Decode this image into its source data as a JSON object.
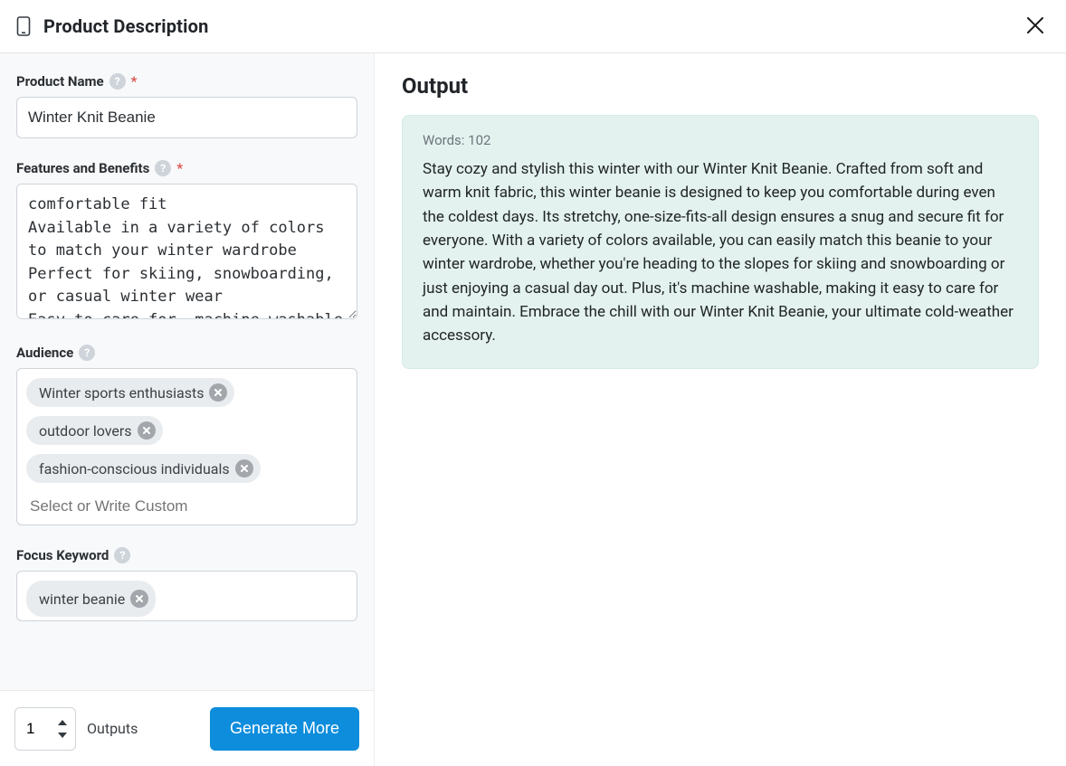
{
  "header": {
    "title": "Product Description"
  },
  "form": {
    "productName": {
      "label": "Product Name",
      "required": true,
      "value": "Winter Knit Beanie"
    },
    "features": {
      "label": "Features and Benefits",
      "required": true,
      "value": "comfortable fit\nAvailable in a variety of colors to match your winter wardrobe\nPerfect for skiing, snowboarding, or casual winter wear\nEasy to care for, machine washable"
    },
    "audience": {
      "label": "Audience",
      "tags": [
        "Winter sports enthusiasts",
        "outdoor lovers",
        "fashion-conscious individuals"
      ],
      "placeholder": "Select or Write Custom"
    },
    "focusKeyword": {
      "label": "Focus Keyword",
      "tags": [
        "winter beanie"
      ]
    }
  },
  "footer": {
    "outputsCount": "1",
    "outputsLabel": "Outputs",
    "generateLabel": "Generate More"
  },
  "output": {
    "heading": "Output",
    "wordCountLabel": "Words: 102",
    "body": "Stay cozy and stylish this winter with our Winter Knit Beanie. Crafted from soft and warm knit fabric, this winter beanie is designed to keep you comfortable during even the coldest days. Its stretchy, one-size-fits-all design ensures a snug and secure fit for everyone. With a variety of colors available, you can easily match this beanie to your winter wardrobe, whether you're heading to the slopes for skiing and snowboarding or just enjoying a casual day out. Plus, it's machine washable, making it easy to care for and maintain. Embrace the chill with our Winter Knit Beanie, your ultimate cold-weather accessory."
  }
}
